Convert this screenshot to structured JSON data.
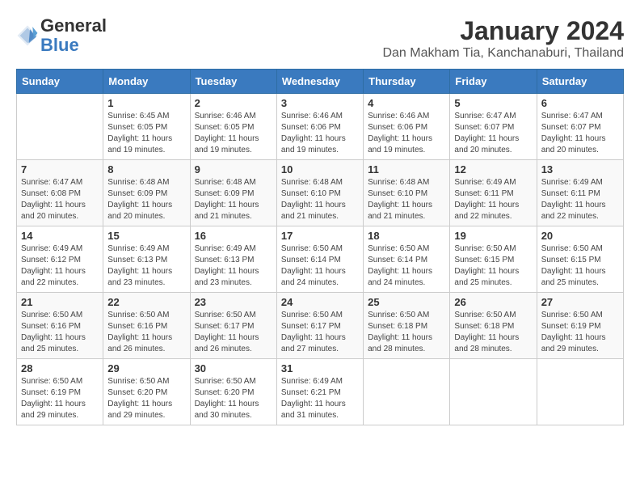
{
  "header": {
    "logo_line1": "General",
    "logo_line2": "Blue",
    "title": "January 2024",
    "subtitle": "Dan Makham Tia, Kanchanaburi, Thailand"
  },
  "days_of_week": [
    "Sunday",
    "Monday",
    "Tuesday",
    "Wednesday",
    "Thursday",
    "Friday",
    "Saturday"
  ],
  "weeks": [
    [
      {
        "day": "",
        "sunrise": "",
        "sunset": "",
        "daylight": ""
      },
      {
        "day": "1",
        "sunrise": "Sunrise: 6:45 AM",
        "sunset": "Sunset: 6:05 PM",
        "daylight": "Daylight: 11 hours and 19 minutes."
      },
      {
        "day": "2",
        "sunrise": "Sunrise: 6:46 AM",
        "sunset": "Sunset: 6:05 PM",
        "daylight": "Daylight: 11 hours and 19 minutes."
      },
      {
        "day": "3",
        "sunrise": "Sunrise: 6:46 AM",
        "sunset": "Sunset: 6:06 PM",
        "daylight": "Daylight: 11 hours and 19 minutes."
      },
      {
        "day": "4",
        "sunrise": "Sunrise: 6:46 AM",
        "sunset": "Sunset: 6:06 PM",
        "daylight": "Daylight: 11 hours and 19 minutes."
      },
      {
        "day": "5",
        "sunrise": "Sunrise: 6:47 AM",
        "sunset": "Sunset: 6:07 PM",
        "daylight": "Daylight: 11 hours and 20 minutes."
      },
      {
        "day": "6",
        "sunrise": "Sunrise: 6:47 AM",
        "sunset": "Sunset: 6:07 PM",
        "daylight": "Daylight: 11 hours and 20 minutes."
      }
    ],
    [
      {
        "day": "7",
        "sunrise": "Sunrise: 6:47 AM",
        "sunset": "Sunset: 6:08 PM",
        "daylight": "Daylight: 11 hours and 20 minutes."
      },
      {
        "day": "8",
        "sunrise": "Sunrise: 6:48 AM",
        "sunset": "Sunset: 6:09 PM",
        "daylight": "Daylight: 11 hours and 20 minutes."
      },
      {
        "day": "9",
        "sunrise": "Sunrise: 6:48 AM",
        "sunset": "Sunset: 6:09 PM",
        "daylight": "Daylight: 11 hours and 21 minutes."
      },
      {
        "day": "10",
        "sunrise": "Sunrise: 6:48 AM",
        "sunset": "Sunset: 6:10 PM",
        "daylight": "Daylight: 11 hours and 21 minutes."
      },
      {
        "day": "11",
        "sunrise": "Sunrise: 6:48 AM",
        "sunset": "Sunset: 6:10 PM",
        "daylight": "Daylight: 11 hours and 21 minutes."
      },
      {
        "day": "12",
        "sunrise": "Sunrise: 6:49 AM",
        "sunset": "Sunset: 6:11 PM",
        "daylight": "Daylight: 11 hours and 22 minutes."
      },
      {
        "day": "13",
        "sunrise": "Sunrise: 6:49 AM",
        "sunset": "Sunset: 6:11 PM",
        "daylight": "Daylight: 11 hours and 22 minutes."
      }
    ],
    [
      {
        "day": "14",
        "sunrise": "Sunrise: 6:49 AM",
        "sunset": "Sunset: 6:12 PM",
        "daylight": "Daylight: 11 hours and 22 minutes."
      },
      {
        "day": "15",
        "sunrise": "Sunrise: 6:49 AM",
        "sunset": "Sunset: 6:13 PM",
        "daylight": "Daylight: 11 hours and 23 minutes."
      },
      {
        "day": "16",
        "sunrise": "Sunrise: 6:49 AM",
        "sunset": "Sunset: 6:13 PM",
        "daylight": "Daylight: 11 hours and 23 minutes."
      },
      {
        "day": "17",
        "sunrise": "Sunrise: 6:50 AM",
        "sunset": "Sunset: 6:14 PM",
        "daylight": "Daylight: 11 hours and 24 minutes."
      },
      {
        "day": "18",
        "sunrise": "Sunrise: 6:50 AM",
        "sunset": "Sunset: 6:14 PM",
        "daylight": "Daylight: 11 hours and 24 minutes."
      },
      {
        "day": "19",
        "sunrise": "Sunrise: 6:50 AM",
        "sunset": "Sunset: 6:15 PM",
        "daylight": "Daylight: 11 hours and 25 minutes."
      },
      {
        "day": "20",
        "sunrise": "Sunrise: 6:50 AM",
        "sunset": "Sunset: 6:15 PM",
        "daylight": "Daylight: 11 hours and 25 minutes."
      }
    ],
    [
      {
        "day": "21",
        "sunrise": "Sunrise: 6:50 AM",
        "sunset": "Sunset: 6:16 PM",
        "daylight": "Daylight: 11 hours and 25 minutes."
      },
      {
        "day": "22",
        "sunrise": "Sunrise: 6:50 AM",
        "sunset": "Sunset: 6:16 PM",
        "daylight": "Daylight: 11 hours and 26 minutes."
      },
      {
        "day": "23",
        "sunrise": "Sunrise: 6:50 AM",
        "sunset": "Sunset: 6:17 PM",
        "daylight": "Daylight: 11 hours and 26 minutes."
      },
      {
        "day": "24",
        "sunrise": "Sunrise: 6:50 AM",
        "sunset": "Sunset: 6:17 PM",
        "daylight": "Daylight: 11 hours and 27 minutes."
      },
      {
        "day": "25",
        "sunrise": "Sunrise: 6:50 AM",
        "sunset": "Sunset: 6:18 PM",
        "daylight": "Daylight: 11 hours and 28 minutes."
      },
      {
        "day": "26",
        "sunrise": "Sunrise: 6:50 AM",
        "sunset": "Sunset: 6:18 PM",
        "daylight": "Daylight: 11 hours and 28 minutes."
      },
      {
        "day": "27",
        "sunrise": "Sunrise: 6:50 AM",
        "sunset": "Sunset: 6:19 PM",
        "daylight": "Daylight: 11 hours and 29 minutes."
      }
    ],
    [
      {
        "day": "28",
        "sunrise": "Sunrise: 6:50 AM",
        "sunset": "Sunset: 6:19 PM",
        "daylight": "Daylight: 11 hours and 29 minutes."
      },
      {
        "day": "29",
        "sunrise": "Sunrise: 6:50 AM",
        "sunset": "Sunset: 6:20 PM",
        "daylight": "Daylight: 11 hours and 29 minutes."
      },
      {
        "day": "30",
        "sunrise": "Sunrise: 6:50 AM",
        "sunset": "Sunset: 6:20 PM",
        "daylight": "Daylight: 11 hours and 30 minutes."
      },
      {
        "day": "31",
        "sunrise": "Sunrise: 6:49 AM",
        "sunset": "Sunset: 6:21 PM",
        "daylight": "Daylight: 11 hours and 31 minutes."
      },
      {
        "day": "",
        "sunrise": "",
        "sunset": "",
        "daylight": ""
      },
      {
        "day": "",
        "sunrise": "",
        "sunset": "",
        "daylight": ""
      },
      {
        "day": "",
        "sunrise": "",
        "sunset": "",
        "daylight": ""
      }
    ]
  ]
}
